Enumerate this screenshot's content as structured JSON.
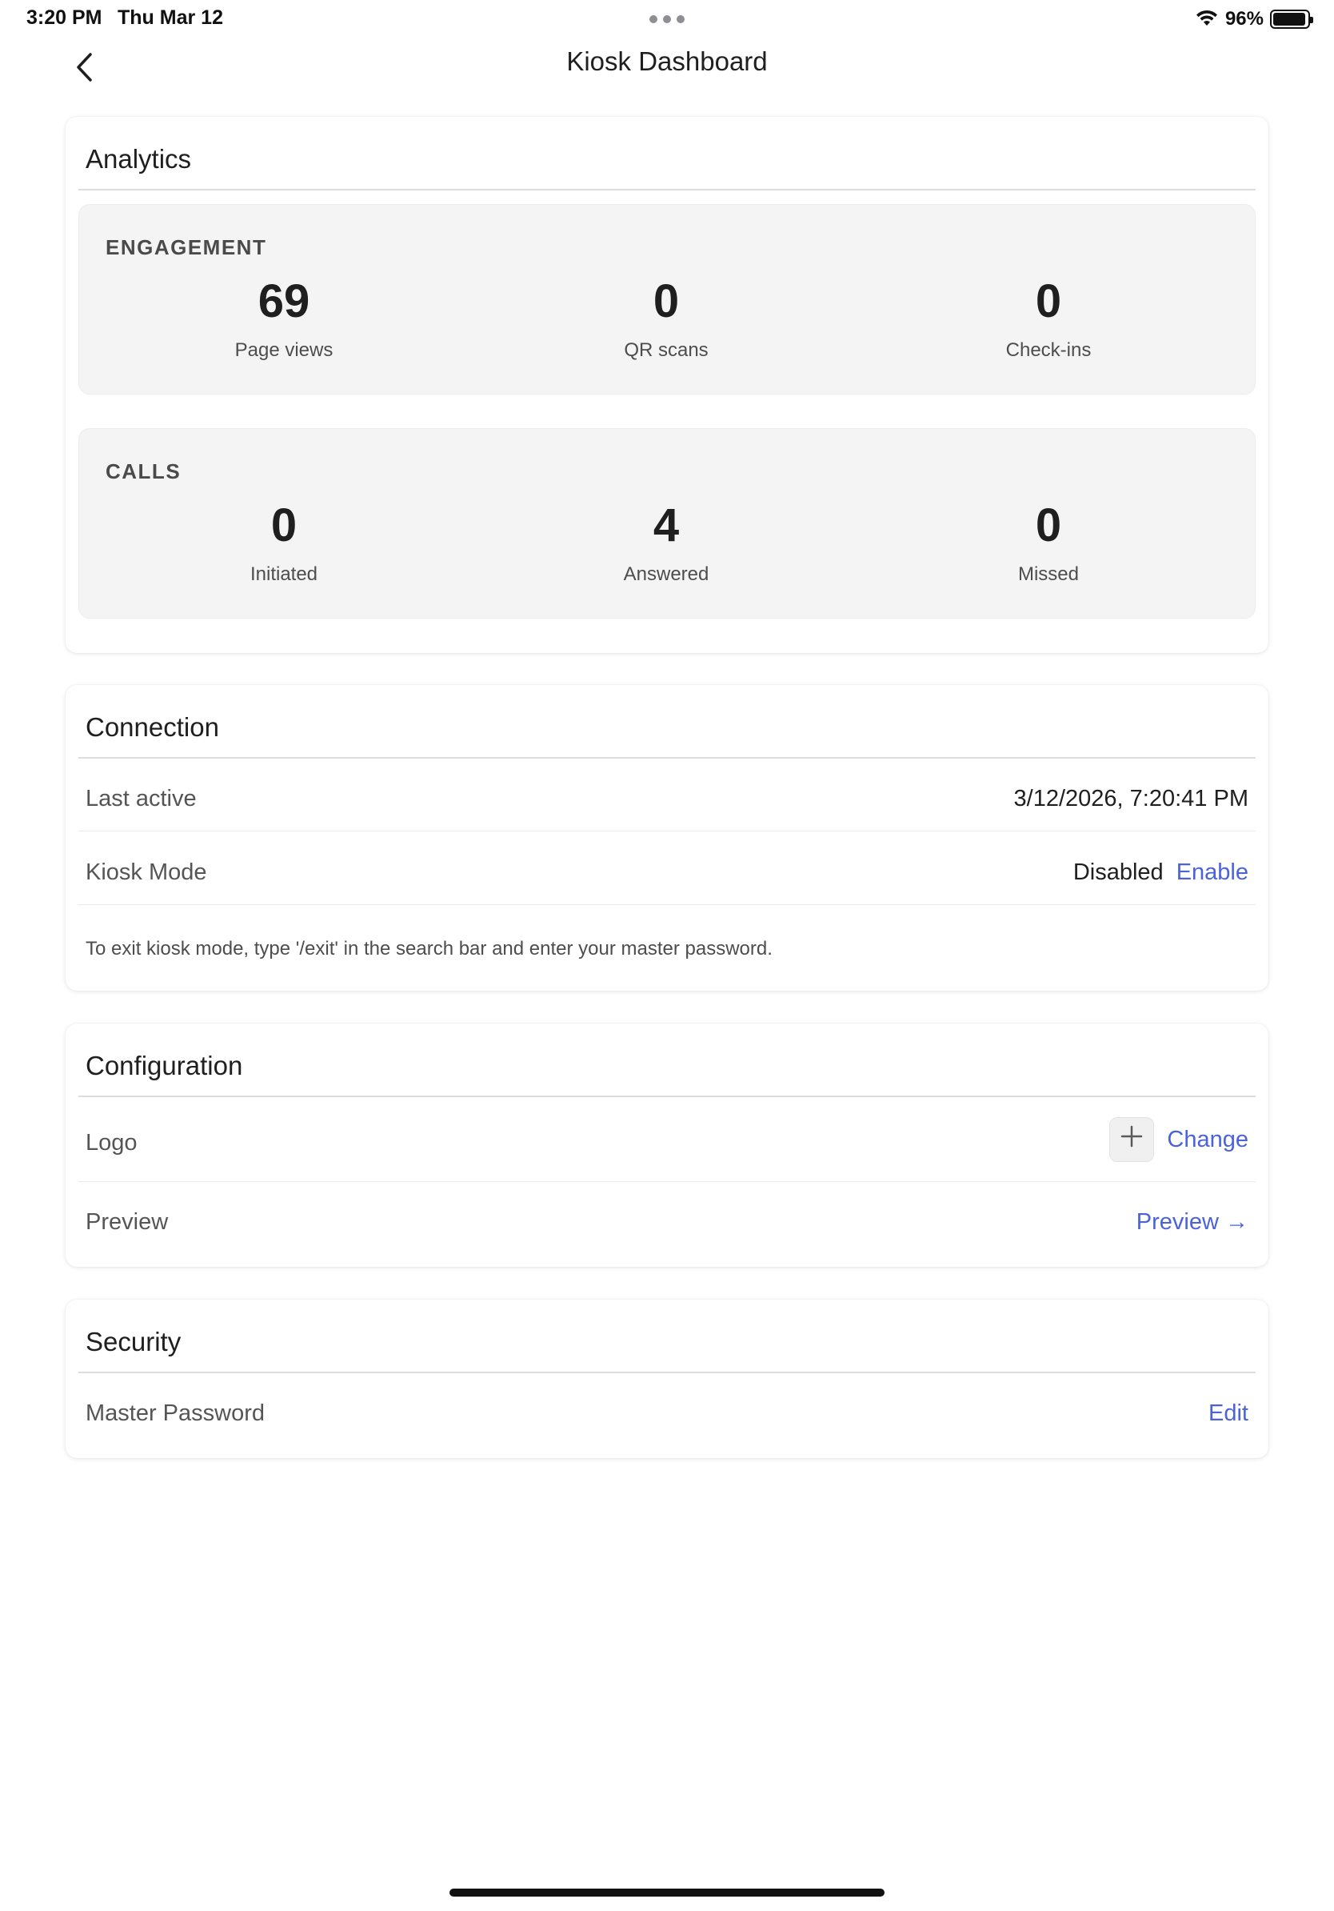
{
  "status_bar": {
    "time": "3:20 PM",
    "date": "Thu Mar 12",
    "battery_pct": "96%",
    "battery_level": 0.96,
    "icons": [
      "wifi-icon",
      "battery-icon",
      "multitask-dots-icon"
    ]
  },
  "nav": {
    "title": "Kiosk Dashboard",
    "back_icon": "chevron-left-icon"
  },
  "analytics": {
    "title": "Analytics",
    "engagement": {
      "title": "ENGAGEMENT",
      "stats": [
        {
          "value": "69",
          "label": "Page views"
        },
        {
          "value": "0",
          "label": "QR scans"
        },
        {
          "value": "0",
          "label": "Check-ins"
        }
      ]
    },
    "calls": {
      "title": "CALLS",
      "stats": [
        {
          "value": "0",
          "label": "Initiated"
        },
        {
          "value": "4",
          "label": "Answered"
        },
        {
          "value": "0",
          "label": "Missed"
        }
      ]
    }
  },
  "connection": {
    "title": "Connection",
    "last_active_label": "Last active",
    "last_active_value": "3/12/2026, 7:20:41 PM",
    "kiosk_mode_label": "Kiosk Mode",
    "kiosk_mode_status": "Disabled",
    "kiosk_mode_action": "Enable",
    "hint": "To exit kiosk mode, type '/exit' in the search bar and enter your master password."
  },
  "configuration": {
    "title": "Configuration",
    "logo_label": "Logo",
    "logo_action": "Change",
    "preview_label": "Preview",
    "preview_action": "Preview →"
  },
  "security": {
    "title": "Security",
    "master_password_label": "Master Password",
    "master_password_action": "Edit"
  },
  "colors": {
    "accent": "#4b63d8",
    "panel_bg": "#f4f4f4",
    "text": "#1f1f1f"
  }
}
